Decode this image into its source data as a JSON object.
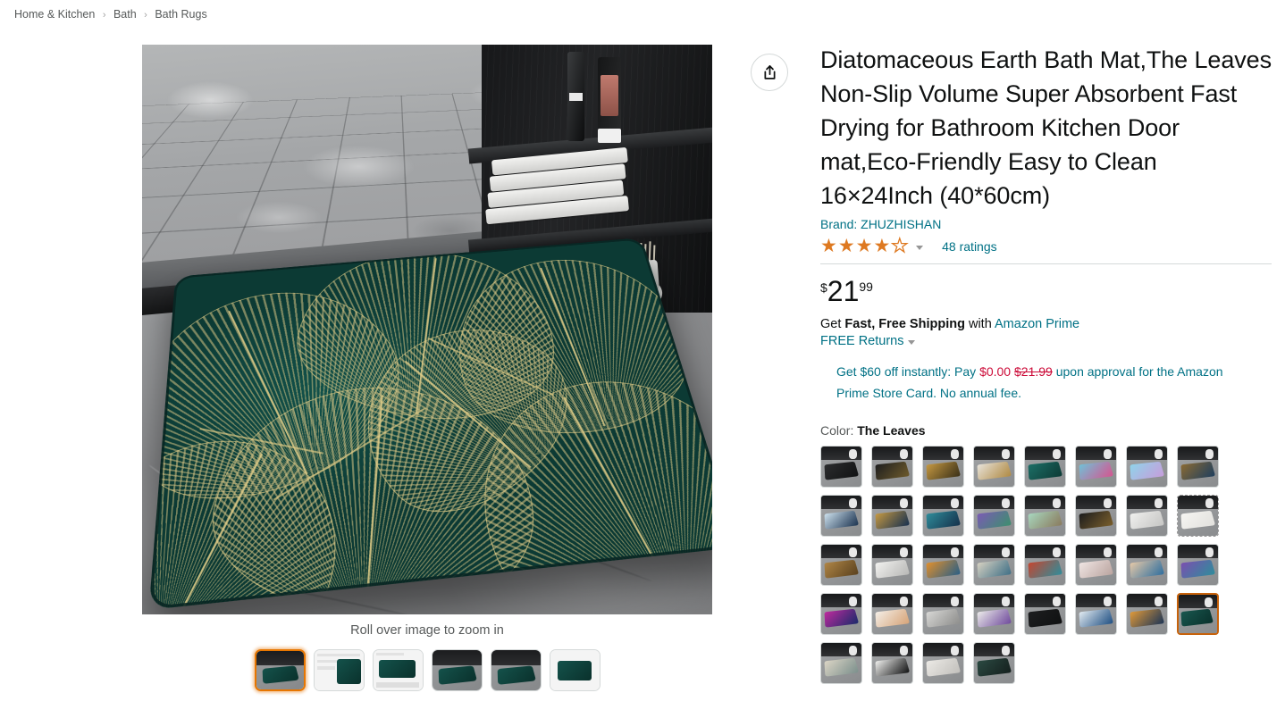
{
  "breadcrumb": {
    "items": [
      "Home & Kitchen",
      "Bath",
      "Bath Rugs"
    ],
    "separator": "›"
  },
  "gallery": {
    "zoom_hint": "Roll over image to zoom in",
    "main_image_alt": "Dark green bath mat with gold leaf pattern on gray marble bathroom floor",
    "thumbnails": [
      {
        "name": "thumbnail-1",
        "selected": true,
        "style": "scene"
      },
      {
        "name": "thumbnail-2",
        "selected": false,
        "style": "infographic"
      },
      {
        "name": "thumbnail-3",
        "selected": false,
        "style": "features"
      },
      {
        "name": "thumbnail-4",
        "selected": false,
        "style": "scene"
      },
      {
        "name": "thumbnail-5",
        "selected": false,
        "style": "scene"
      },
      {
        "name": "thumbnail-6",
        "selected": false,
        "style": "flatlay"
      }
    ]
  },
  "share": {
    "icon": "share-icon",
    "label": "Share"
  },
  "product": {
    "title": "Diatomaceous Earth Bath Mat,The Leaves Non-Slip Volume Super Absorbent Fast Drying for Bathroom Kitchen Door mat,Eco-Friendly Easy to Clean 16×24Inch (40*60cm)",
    "brand_line": "Brand: ZHUZHISHAN",
    "rating_value": 4,
    "rating_max": 5,
    "ratings_count": "48 ratings",
    "price": {
      "symbol": "$",
      "whole": "21",
      "fraction": "99"
    },
    "shipping": {
      "prefix": "Get ",
      "bold": "Fast, Free Shipping",
      "middle": " with ",
      "link": "Amazon Prime"
    },
    "returns": {
      "label": "FREE Returns"
    },
    "promo": {
      "part1": "Get $60 off instantly: Pay ",
      "pay_amount": "$0.00",
      "struck_amount": "$21.99",
      "part2": " upon approval for the Amazon Prime Store Card. No annual fee."
    }
  },
  "color_selector": {
    "label": "Color:",
    "selected_value": "The Leaves",
    "swatches": [
      {
        "name": "swatch-monochrome-bottles",
        "mat": "linear-gradient(135deg,#2b2c2e,#121314)",
        "selected": false,
        "unavailable": false
      },
      {
        "name": "swatch-black-gold",
        "mat": "linear-gradient(135deg,#1c1d1f,#6d5a2c)",
        "selected": false,
        "unavailable": false
      },
      {
        "name": "swatch-gold-marble",
        "mat": "linear-gradient(135deg,#c79a42,#3b3119)",
        "selected": false,
        "unavailable": false
      },
      {
        "name": "swatch-white-gold-marble",
        "mat": "linear-gradient(135deg,#e8e4dc,#b08a43)",
        "selected": false,
        "unavailable": false
      },
      {
        "name": "swatch-teal-marble",
        "mat": "linear-gradient(135deg,#1d6f67,#0d3b36)",
        "selected": false,
        "unavailable": false
      },
      {
        "name": "swatch-pink-blue-marble",
        "mat": "linear-gradient(135deg,#6fc2d8,#d5558f)",
        "selected": false,
        "unavailable": false
      },
      {
        "name": "swatch-lilac-blue",
        "mat": "linear-gradient(135deg,#8fd4ea,#c79ddb)",
        "selected": false,
        "unavailable": false
      },
      {
        "name": "swatch-navy-gold",
        "mat": "linear-gradient(135deg,#8b6a33,#1f3f5e)",
        "selected": false,
        "unavailable": false
      },
      {
        "name": "swatch-blue-white-gold",
        "mat": "linear-gradient(135deg,#cfe3ef,#1c3350)",
        "selected": false,
        "unavailable": false
      },
      {
        "name": "swatch-blue-gold-swirl",
        "mat": "linear-gradient(135deg,#c79a42,#17304f)",
        "selected": false,
        "unavailable": false
      },
      {
        "name": "swatch-teal-blue-abstract",
        "mat": "linear-gradient(135deg,#2f8d9b,#16324c)",
        "selected": false,
        "unavailable": false
      },
      {
        "name": "swatch-purple-floral",
        "mat": "linear-gradient(135deg,#7c5ab5,#3d8f6e)",
        "selected": false,
        "unavailable": false
      },
      {
        "name": "swatch-mint-shell",
        "mat": "linear-gradient(135deg,#a8d8c0,#8a7b5e)",
        "selected": false,
        "unavailable": false
      },
      {
        "name": "swatch-black-gold-circle",
        "mat": "linear-gradient(135deg,#1a1b1d,#7a5f2c)",
        "selected": false,
        "unavailable": false
      },
      {
        "name": "swatch-white-marble",
        "mat": "linear-gradient(135deg,#f0f0ee,#c6c6c4)",
        "selected": false,
        "unavailable": false
      },
      {
        "name": "swatch-cream-unavailable",
        "mat": "linear-gradient(135deg,#f6f5f2,#e2e1dd)",
        "selected": false,
        "unavailable": true
      },
      {
        "name": "swatch-brown-gold-marble",
        "mat": "linear-gradient(135deg,#b08646,#5b421f)",
        "selected": false,
        "unavailable": false
      },
      {
        "name": "swatch-white-grey-marble",
        "mat": "linear-gradient(135deg,#f2f2f0,#b9b9b7)",
        "selected": false,
        "unavailable": false
      },
      {
        "name": "swatch-orange-blue",
        "mat": "linear-gradient(135deg,#e2902c,#2a5f86)",
        "selected": false,
        "unavailable": false
      },
      {
        "name": "swatch-pastel-abstract",
        "mat": "linear-gradient(135deg,#d8d2c2,#3f6f86)",
        "selected": false,
        "unavailable": false
      },
      {
        "name": "swatch-red-teal-abstract",
        "mat": "linear-gradient(135deg,#c6452f,#2f8d9b)",
        "selected": false,
        "unavailable": false
      },
      {
        "name": "swatch-blush-marble",
        "mat": "linear-gradient(135deg,#f0e6e4,#bba5a0)",
        "selected": false,
        "unavailable": false
      },
      {
        "name": "swatch-blue-peach-marble",
        "mat": "linear-gradient(135deg,#e6c9a8,#2f6e9e)",
        "selected": false,
        "unavailable": false
      },
      {
        "name": "swatch-violet-teal",
        "mat": "linear-gradient(135deg,#7b4fb0,#2f8d9b)",
        "selected": false,
        "unavailable": false
      },
      {
        "name": "swatch-magenta-galaxy",
        "mat": "linear-gradient(135deg,#c02a9e,#1b2a6b)",
        "selected": false,
        "unavailable": false
      },
      {
        "name": "swatch-peach-white",
        "mat": "linear-gradient(135deg,#f4efe8,#d7a478)",
        "selected": false,
        "unavailable": false
      },
      {
        "name": "swatch-grey-stripes",
        "mat": "linear-gradient(135deg,#d8d8d6,#8e8e8c)",
        "selected": false,
        "unavailable": false
      },
      {
        "name": "swatch-white-purple",
        "mat": "linear-gradient(135deg,#ededeb,#6f4a9c)",
        "selected": false,
        "unavailable": false
      },
      {
        "name": "swatch-black-texture",
        "mat": "linear-gradient(135deg,#1d1e20,#101112)",
        "selected": false,
        "unavailable": false
      },
      {
        "name": "swatch-blue-white-wave",
        "mat": "linear-gradient(135deg,#e4ecf2,#1f4f82)",
        "selected": false,
        "unavailable": false
      },
      {
        "name": "swatch-sunset-landscape",
        "mat": "linear-gradient(135deg,#e09a3a,#1d3556)",
        "selected": false,
        "unavailable": false
      },
      {
        "name": "swatch-the-leaves",
        "mat": "linear-gradient(135deg,#18574f,#0a312c)",
        "selected": true,
        "unavailable": false
      },
      {
        "name": "swatch-beige-abstract",
        "mat": "linear-gradient(135deg,#ddd6c6,#7b8f8c)",
        "selected": false,
        "unavailable": false
      },
      {
        "name": "swatch-black-white-splash",
        "mat": "linear-gradient(135deg,#f2f2f0,#101112)",
        "selected": false,
        "unavailable": false
      },
      {
        "name": "swatch-light-grey-stone",
        "mat": "linear-gradient(135deg,#eceae6,#c2c0bc)",
        "selected": false,
        "unavailable": false
      },
      {
        "name": "swatch-dark-green-leaf",
        "mat": "linear-gradient(135deg,#2b4a42,#15201e)",
        "selected": false,
        "unavailable": false
      }
    ]
  },
  "colors": {
    "link": "#007185",
    "accent_orange": "#de7921",
    "selected_border": "#c7620b",
    "promo_red": "#CC0C39",
    "text": "#0F1111",
    "muted": "#565959",
    "divider": "#d5d9d9"
  }
}
